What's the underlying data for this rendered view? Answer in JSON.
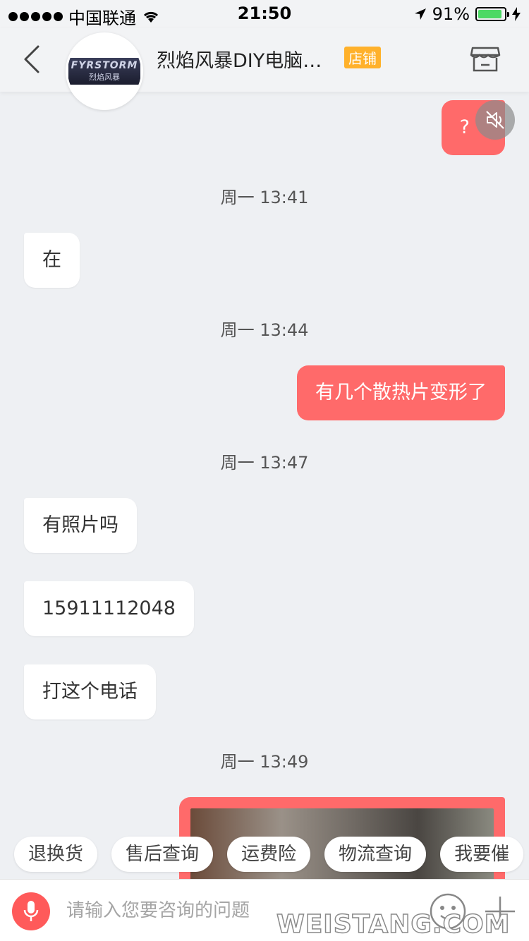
{
  "status_bar": {
    "carrier": "中国联通",
    "time": "21:50",
    "battery": "91%"
  },
  "header": {
    "shop_name": "烈焰风暴DIY电脑…",
    "badge": "店铺",
    "avatar_line1": "FYRSTORM",
    "avatar_line2": "烈焰风暴"
  },
  "messages": {
    "m0": "?",
    "t1": "周一 13:41",
    "m1": "在",
    "t2": "周一 13:44",
    "m2": "有几个散热片变形了",
    "t3": "周一 13:47",
    "m3": "有照片吗",
    "m4": "15911112048",
    "m5": "打这个电话",
    "t4": "周一 13:49"
  },
  "quick_replies": [
    "退换货",
    "售后查询",
    "运费险",
    "物流查询",
    "我要催"
  ],
  "input": {
    "placeholder": "请输入您要咨询的问题"
  },
  "watermark": "WEISTANG.COM",
  "colors": {
    "accent": "#ff6a6a",
    "badge": "#ffb12b",
    "background": "#eef0f3"
  }
}
